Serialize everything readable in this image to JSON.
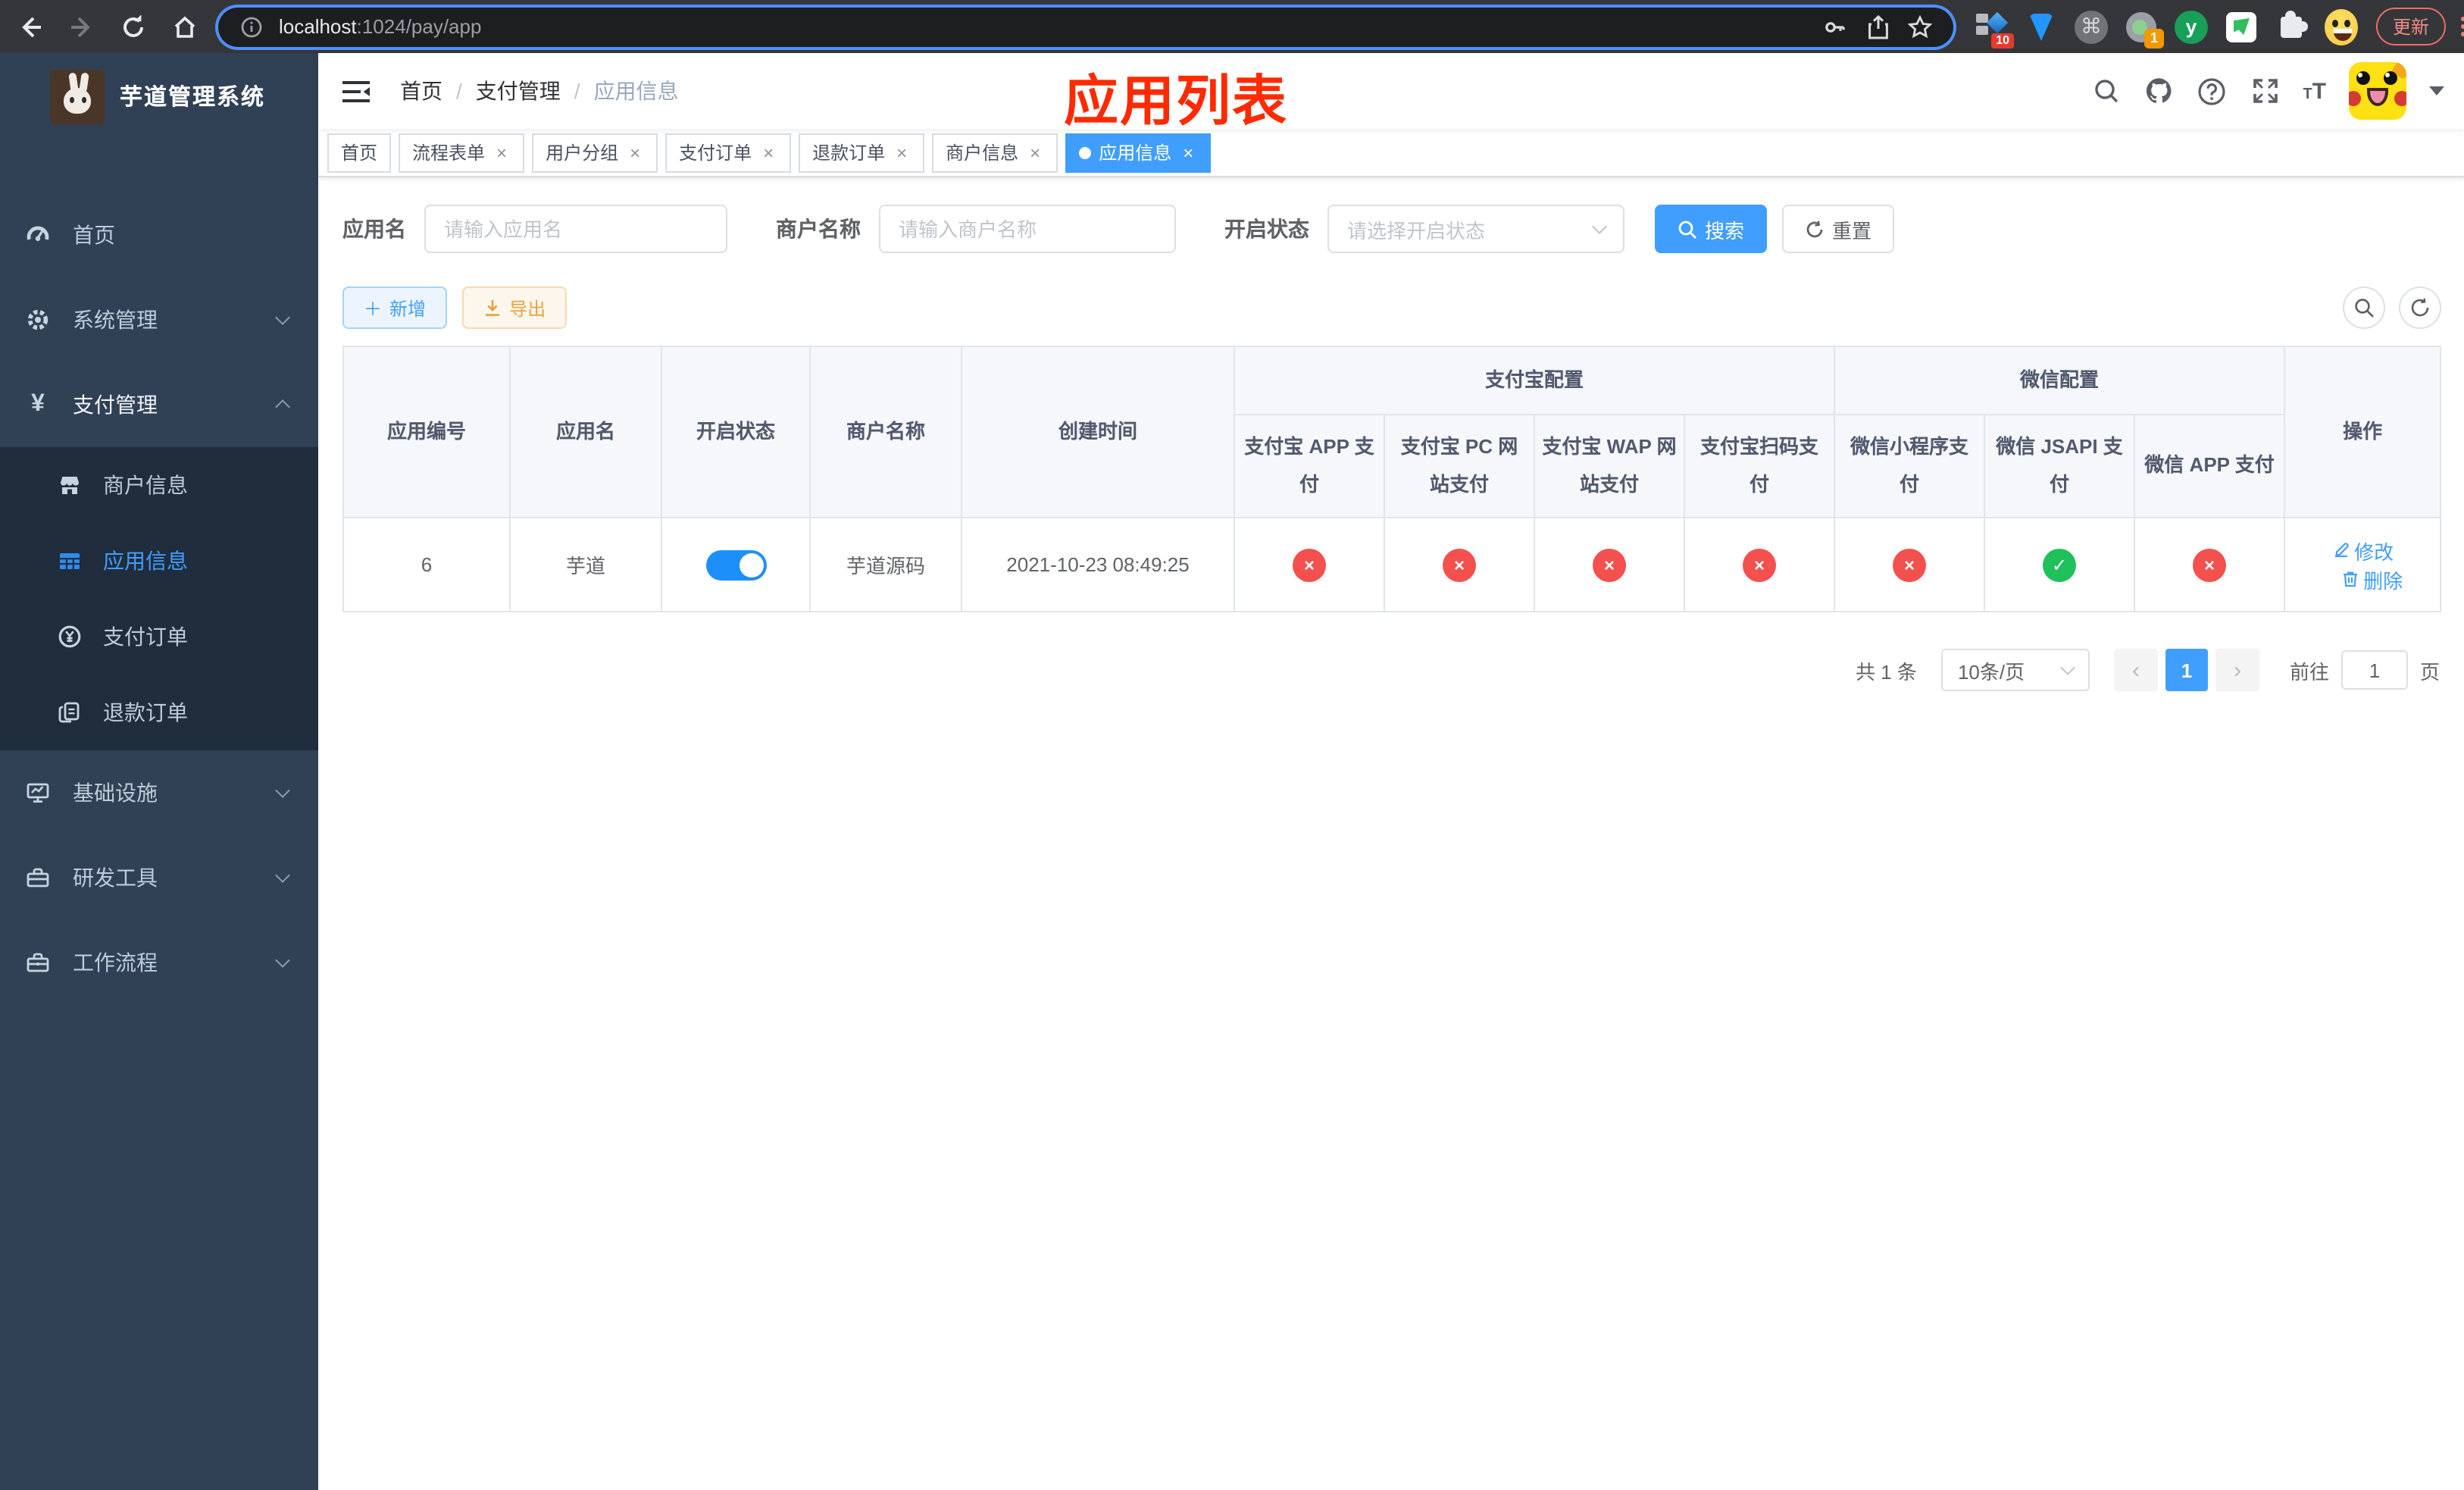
{
  "browser": {
    "url": {
      "host": "localhost",
      "rest": ":1024/pay/app"
    },
    "update_label": "更新",
    "ext_badge_10": "10",
    "ext_badge_1": "1",
    "ext_y": "y",
    "ext_cmd": "⌘"
  },
  "sidebar": {
    "title": "芋道管理系统",
    "items": [
      {
        "label": "首页",
        "icon": "dashboard-icon"
      },
      {
        "label": "系统管理",
        "icon": "gear-icon",
        "state": "collapsed"
      },
      {
        "label": "支付管理",
        "icon": "yen-icon",
        "state": "expanded"
      },
      {
        "label": "商户信息",
        "icon": "shop-icon",
        "level": "sub"
      },
      {
        "label": "应用信息",
        "icon": "grid-icon",
        "level": "sub",
        "active": true
      },
      {
        "label": "支付订单",
        "icon": "yen-circle-icon",
        "level": "sub"
      },
      {
        "label": "退款订单",
        "icon": "docs-icon",
        "level": "sub"
      },
      {
        "label": "基础设施",
        "icon": "monitor-icon",
        "state": "collapsed"
      },
      {
        "label": "研发工具",
        "icon": "toolbox-icon",
        "state": "collapsed"
      },
      {
        "label": "工作流程",
        "icon": "toolbox-icon",
        "state": "collapsed"
      }
    ],
    "yen_glyph": "¥"
  },
  "header": {
    "breadcrumb": [
      "首页",
      "支付管理",
      "应用信息"
    ],
    "separator": "/",
    "annotation": "应用列表",
    "font_icon_small": "T",
    "font_icon_big": "T"
  },
  "tabs": [
    {
      "label": "首页",
      "closable": false,
      "active": false
    },
    {
      "label": "流程表单",
      "closable": true,
      "active": false
    },
    {
      "label": "用户分组",
      "closable": true,
      "active": false
    },
    {
      "label": "支付订单",
      "closable": true,
      "active": false
    },
    {
      "label": "退款订单",
      "closable": true,
      "active": false
    },
    {
      "label": "商户信息",
      "closable": true,
      "active": false
    },
    {
      "label": "应用信息",
      "closable": true,
      "active": true
    }
  ],
  "icons": {
    "close": "×",
    "plus": "＋",
    "x": "×",
    "check": "✓",
    "prev": "‹",
    "next": "›"
  },
  "filters": {
    "app_name_label": "应用名",
    "app_name_placeholder": "请输入应用名",
    "merchant_label": "商户名称",
    "merchant_placeholder": "请输入商户名称",
    "status_label": "开启状态",
    "status_placeholder": "请选择开启状态",
    "search_label": "搜索",
    "reset_label": "重置"
  },
  "toolbar": {
    "add_label": "新增",
    "export_label": "导出"
  },
  "table": {
    "headers": {
      "id": "应用编号",
      "name": "应用名",
      "status": "开启状态",
      "merchant": "商户名称",
      "created": "创建时间",
      "alipay_group": "支付宝配置",
      "wechat_group": "微信配置",
      "alipay": [
        "支付宝 APP 支付",
        "支付宝 PC 网站支付",
        "支付宝 WAP 网站支付",
        "支付宝扫码支付"
      ],
      "wechat": [
        "微信小程序支付",
        "微信 JSAPI 支付",
        "微信 APP 支付"
      ],
      "ops": "操作"
    },
    "rows": [
      {
        "id": "6",
        "name": "芋道",
        "status_enabled": true,
        "merchant": "芋道源码",
        "created": "2021-10-23 08:49:25",
        "configs": [
          {
            "name": "alipay-app",
            "enabled": false
          },
          {
            "name": "alipay-pc",
            "enabled": false
          },
          {
            "name": "alipay-wap",
            "enabled": false
          },
          {
            "name": "alipay-qr",
            "enabled": false
          },
          {
            "name": "wechat-lite",
            "enabled": false
          },
          {
            "name": "wechat-jsapi",
            "enabled": true
          },
          {
            "name": "wechat-app",
            "enabled": false
          }
        ],
        "ops": {
          "edit": "修改",
          "delete": "删除"
        }
      }
    ]
  },
  "pagination": {
    "total": "共 1 条",
    "page_size": "10条/页",
    "current_page": "1",
    "goto_label": "前往",
    "goto_value": "1",
    "page_unit": "页"
  },
  "colors": {
    "primary": "#409eff",
    "danger": "#f4504d",
    "success": "#20c05c",
    "warning": "#e6a23c",
    "toggle_on": "#1d8ffa",
    "annotation_red": "#ff2a00",
    "sidebar_bg": "#304156",
    "submenu_bg": "#1f2d3d"
  }
}
